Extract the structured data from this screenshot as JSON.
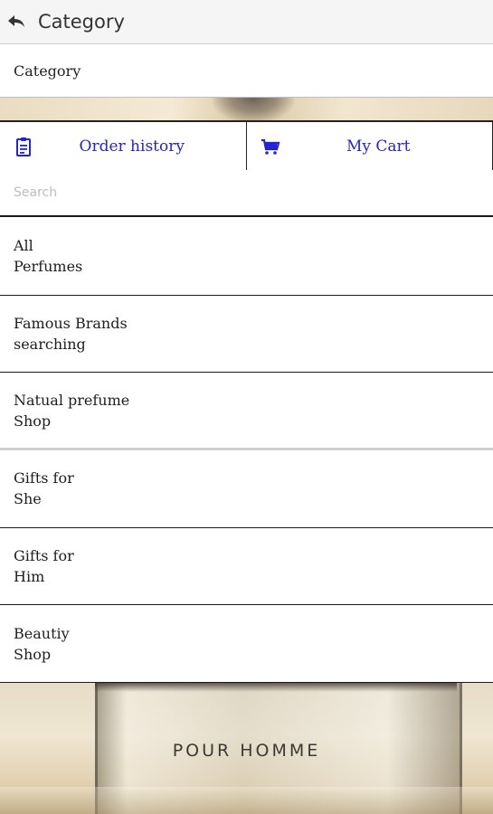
{
  "appbar": {
    "title": "Category",
    "back_icon": "back-arrow-icon"
  },
  "category_label": "Category",
  "actions": {
    "order_history": {
      "label": "Order history",
      "icon": "clipboard-icon",
      "color": "#2323d8"
    },
    "my_cart": {
      "label": "My Cart",
      "icon": "cart-icon",
      "color": "#2323d8"
    }
  },
  "search": {
    "placeholder": "Search",
    "value": ""
  },
  "categories": [
    {
      "line1": "All",
      "line2": "Perfumes"
    },
    {
      "line1": "Famous Brands",
      "line2": "searching"
    },
    {
      "line1": "Natual prefume",
      "line2": "Shop"
    },
    {
      "line1": "Gifts for",
      "line2": "She"
    },
    {
      "line1": "Gifts for",
      "line2": "Him"
    },
    {
      "line1": "Beautiy",
      "line2": "Shop"
    }
  ],
  "background": {
    "bottle_text": "POUR HOMME"
  }
}
